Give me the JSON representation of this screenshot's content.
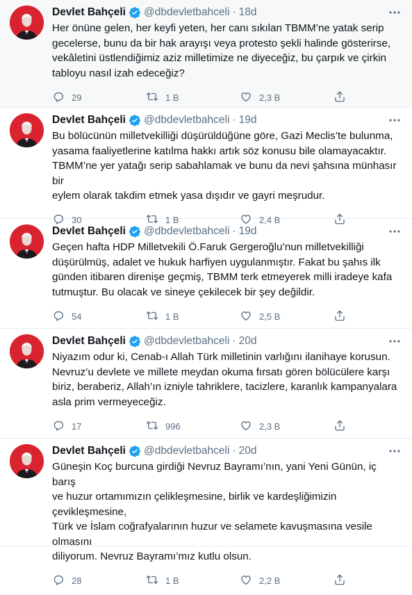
{
  "colors": {
    "accent": "#1da1f2",
    "muted": "#5b7083",
    "text": "#0f1419",
    "avatar_bg": "#d9232e"
  },
  "tweets": [
    {
      "name": "Devlet Bahçeli",
      "handle": "@dbdevletbahceli",
      "dot": "·",
      "time": "18d",
      "lines": [
        "Her önüne gelen, her keyfi yeten, her canı sıkılan TBMM’ne yatak serip",
        "gecelerse, bunu da bir hak arayışı veya protesto şekli halinde gösterirse,",
        "vekâletini üstlendiğimiz aziz milletimize ne diyeceğiz, bu çarpık ve çirkin",
        "tabloyu nasıl izah edeceğiz?"
      ],
      "replies": "29",
      "retweets": "1 B",
      "likes": "2,3 B"
    },
    {
      "name": "Devlet Bahçeli",
      "handle": "@dbdevletbahceli",
      "dot": "·",
      "time": "19d",
      "lines": [
        "Bu bölücünün milletvekilliği düşürüldüğüne göre, Gazi Meclis’te bulunma,",
        "yasama faaliyetlerine katılma hakkı artık söz konusu bile olamayacaktır.",
        "TBMM’ne yer yatağı serip sabahlamak ve bunu da nevi şahsına münhasır bir",
        "eylem olarak takdim etmek yasa dışıdır ve gayri meşrudur."
      ],
      "replies": "30",
      "retweets": "1 B",
      "likes": "2,4 B"
    },
    {
      "name": "Devlet Bahçeli",
      "handle": "@dbdevletbahceli",
      "dot": "·",
      "time": "19d",
      "lines": [
        "Geçen hafta HDP Milletvekili Ö.Faruk Gergeroğlu’nun milletvekilliği",
        "düşürülmüş, adalet ve hukuk harfiyen uygulanmıştır. Fakat bu şahıs ilk",
        "günden itibaren direnişe geçmiş, TBMM terk etmeyerek milli iradeye kafa",
        "tutmuştur. Bu olacak ve sineye çekilecek bir şey değildir."
      ],
      "replies": "54",
      "retweets": "1 B",
      "likes": "2,5 B"
    },
    {
      "name": "Devlet Bahçeli",
      "handle": "@dbdevletbahceli",
      "dot": "·",
      "time": "20d",
      "lines": [
        "Niyazım odur ki, Cenab-ı Allah Türk milletinin varlığını ilanihaye korusun.",
        "Nevruz’u devlete ve millete meydan okuma fırsatı gören bölücülere karşı",
        "biriz, beraberiz, Allah’ın izniyle tahriklere, tacizlere, karanlık kampanyalara",
        "asla prim vermeyeceğiz."
      ],
      "replies": "17",
      "retweets": "996",
      "likes": "2,3 B"
    },
    {
      "name": "Devlet Bahçeli",
      "handle": "@dbdevletbahceli",
      "dot": "·",
      "time": "20d",
      "lines": [
        "Güneşin Koç burcuna girdiği Nevruz Bayramı’nın, yani Yeni Günün, iç barış",
        "ve huzur ortamımızın çelikleşmesine, birlik ve kardeşliğimizin çevikleşmesine,",
        "Türk ve İslam coğrafyalarının huzur ve selamete kavuşmasına vesile olmasını",
        "diliyorum. Nevruz Bayramı’mız kutlu olsun."
      ],
      "replies": "28",
      "retweets": "1 B",
      "likes": "2,2 B"
    }
  ]
}
